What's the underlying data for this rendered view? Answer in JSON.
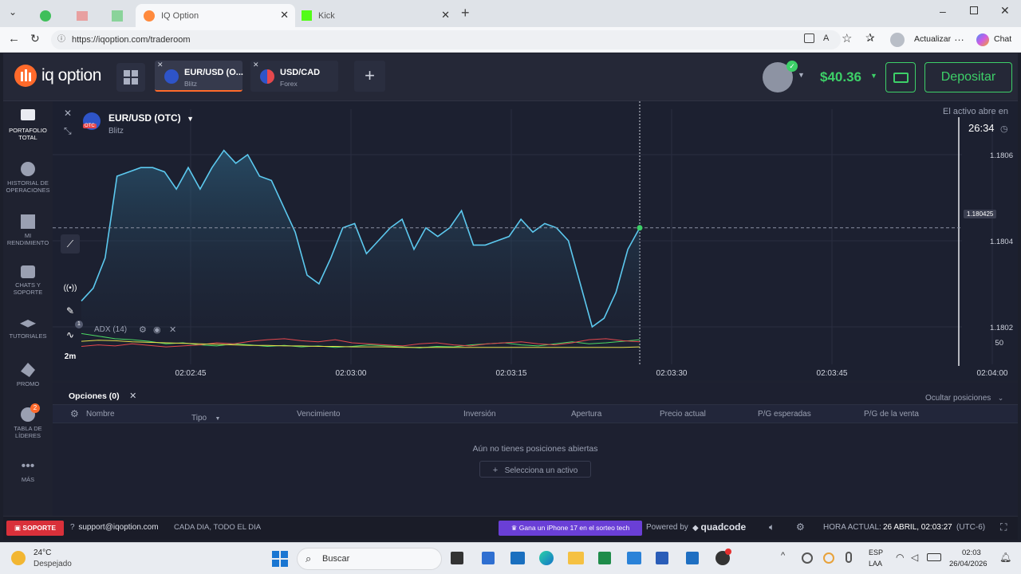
{
  "browser": {
    "tabs": [
      {
        "label": "",
        "icon": "whatsapp-icon"
      },
      {
        "label": "",
        "icon": "mail-icon"
      },
      {
        "label": "",
        "icon": "sheets-icon"
      },
      {
        "label": "IQ Option",
        "icon": "iq-option-icon",
        "active": true
      },
      {
        "label": "Kick",
        "icon": "kick-icon"
      }
    ],
    "url": "https://iqoption.com/traderoom",
    "update_label": "Actualizar",
    "copilot_label": "Chat"
  },
  "app": {
    "logo_text": "iq option",
    "asset_tabs": [
      {
        "name": "EUR/USD (O...",
        "sub": "Blitz"
      },
      {
        "name": "USD/CAD",
        "sub": "Forex"
      }
    ],
    "balance": "$40.36",
    "deposit_label": "Depositar",
    "sidebar": [
      {
        "label": "PORTAFOLIO TOTAL",
        "icon": "briefcase-icon"
      },
      {
        "label": "HISTORIAL DE OPERACIONES",
        "icon": "clock-icon"
      },
      {
        "label": "MI RENDIMIENTO",
        "icon": "dashboard-icon"
      },
      {
        "label": "CHATS Y SOPORTE",
        "icon": "chat-icon"
      },
      {
        "label": "TUTORIALES",
        "icon": "graduation-cap-icon"
      },
      {
        "label": "PROMO",
        "icon": "promo-icon"
      },
      {
        "label": "TABLA DE LÍDERES",
        "icon": "leaderboard-icon",
        "badge": "2"
      },
      {
        "label": "MÁS",
        "icon": "more-icon"
      }
    ],
    "chart_header": {
      "asset": "EUR/USD (OTC)",
      "type": "Blitz",
      "opens_label": "El activo abre en",
      "timer": "26:34"
    },
    "indicator_label": "ADX (14)",
    "timeframe": "2m",
    "indicator_count": "1",
    "positions": {
      "tab_label": "Opciones (0)",
      "hide_label": "Ocultar posiciones",
      "columns": [
        "Nombre",
        "Tipo",
        "Vencimiento",
        "Inversión",
        "Apertura",
        "Precio actual",
        "P/G esperadas",
        "P/G de la venta"
      ],
      "empty_message": "Aún no tienes posiciones abiertas",
      "select_asset": "Selecciona un activo"
    },
    "statusbar": {
      "support": "SOPORTE",
      "email": "support@iqoption.com",
      "hours": "CADA DIA, TODO EL DIA",
      "promo": "Gana un iPhone 17 en el sorteo tech",
      "powered": "Powered by",
      "brand": "quadcode",
      "time_label": "HORA ACTUAL:",
      "time_value": "26 ABRIL, 02:03:27",
      "tz": "(UTC-6)"
    }
  },
  "chart_data": {
    "type": "area",
    "x_ticks": [
      "02:02:45",
      "02:03:00",
      "02:03:15",
      "02:03:30",
      "02:03:45",
      "02:04:00"
    ],
    "y_ticks": [
      "1.1806",
      "1.1804",
      "1.1802"
    ],
    "current_price": "1.180425",
    "adx_level": "50",
    "price_series": [
      1.18026,
      1.18029,
      1.18036,
      1.18055,
      1.18056,
      1.18057,
      1.18057,
      1.18056,
      1.18052,
      1.18057,
      1.18052,
      1.18057,
      1.18061,
      1.18058,
      1.1806,
      1.18055,
      1.18054,
      1.18048,
      1.18042,
      1.18032,
      1.1803,
      1.18036,
      1.18043,
      1.18044,
      1.18037,
      1.1804,
      1.18043,
      1.18045,
      1.18038,
      1.18043,
      1.18041,
      1.18043,
      1.18047,
      1.18039,
      1.18039,
      1.1804,
      1.18041,
      1.18045,
      1.18042,
      1.18044,
      1.18043,
      1.1804,
      1.1803,
      1.1802,
      1.18022,
      1.18028,
      1.18038,
      1.18043
    ],
    "adx_series": [
      {
        "color": "#4cd964",
        "values": [
          60,
          55,
          50,
          48,
          45,
          40,
          42,
          38,
          36,
          40,
          38,
          35,
          37,
          34,
          36,
          33,
          35,
          38,
          36,
          34,
          32,
          35,
          34,
          38,
          40,
          42,
          38,
          36,
          40,
          44,
          40,
          42,
          45,
          48
        ]
      },
      {
        "color": "#e5484d",
        "values": [
          35,
          38,
          36,
          40,
          37,
          34,
          36,
          38,
          42,
          40,
          45,
          48,
          50,
          46,
          44,
          48,
          42,
          40,
          38,
          36,
          40,
          42,
          38,
          36,
          40,
          42,
          44,
          40,
          38,
          42,
          48,
          50,
          46,
          44
        ]
      },
      {
        "color": "#e6e04a",
        "values": [
          45,
          47,
          46,
          44,
          43,
          42,
          41,
          40,
          39,
          38,
          37,
          37,
          36,
          36,
          35,
          35,
          34,
          34,
          34,
          33,
          33,
          33,
          33,
          33,
          33,
          33,
          33,
          33,
          33,
          33,
          33,
          33,
          33,
          34
        ]
      }
    ]
  },
  "taskbar": {
    "weather_temp": "24°C",
    "weather_desc": "Despejado",
    "search_placeholder": "Buscar",
    "lang1": "ESP",
    "lang2": "LAA",
    "clock_time": "02:03",
    "clock_date": "26/04/2026"
  },
  "colors": {
    "accent_green": "#3dd068",
    "line": "#5cc9ef",
    "brand_orange": "#ff6a2b"
  }
}
